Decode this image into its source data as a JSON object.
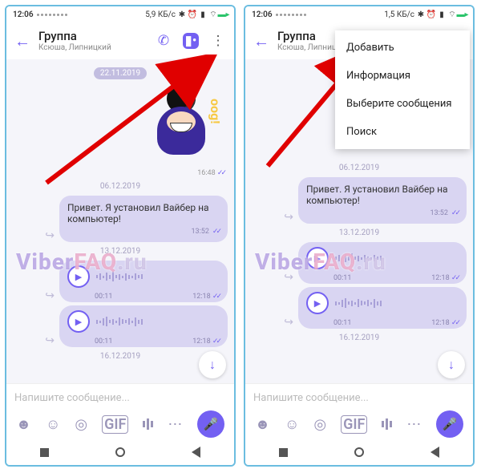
{
  "statusbar": {
    "time": "12:06",
    "net_speed_a": "5,9 КБ/с",
    "net_speed_b": "1,5 КБ/с"
  },
  "header": {
    "title": "Группа",
    "subtitle": "Ксюша, Липницкий"
  },
  "dates": {
    "d1": "22.11.2019",
    "d2": "06.12.2019",
    "d3": "13.12.2019",
    "d4": "16.12.2019"
  },
  "sticker": {
    "time": "16:48",
    "side_label": "oog!"
  },
  "messages": {
    "text1": {
      "body": "Привет. Я установил Вайбер на компьютер!",
      "time": "13:52"
    },
    "voice1": {
      "duration": "00:11",
      "time": "12:18"
    },
    "voice2": {
      "duration": "00:11",
      "time": "12:18"
    }
  },
  "composer": {
    "placeholder": "Напишите сообщение...",
    "gif_label": "GIF"
  },
  "menu": {
    "add": "Добавить",
    "info": "Информация",
    "select": "Выберите сообщения",
    "search": "Поиск"
  },
  "watermark": {
    "p1": "Viber",
    "p2": "FAQ",
    "p3": ".ru"
  }
}
